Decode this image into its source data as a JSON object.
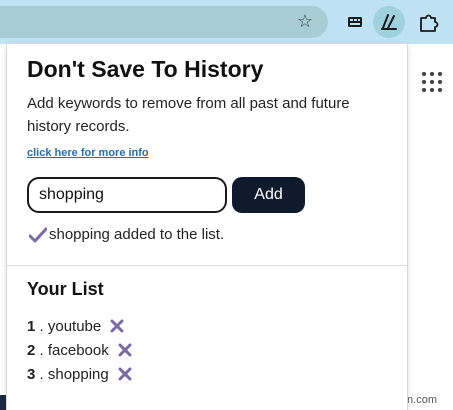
{
  "popup": {
    "title": "Don't Save To History",
    "description": "Add keywords to remove from all past and future history records.",
    "more_info_link": "click here for more info",
    "input_value": "shopping",
    "add_label": "Add",
    "status_message": "shopping added to the list.",
    "list_title": "Your List",
    "items": [
      {
        "number": "1",
        "separator": " . ",
        "label": "youtube"
      },
      {
        "number": "2",
        "separator": " . ",
        "label": "facebook"
      },
      {
        "number": "3",
        "separator": " . ",
        "label": "shopping"
      }
    ]
  },
  "watermark": "wsxdn.com",
  "icons": {
    "bookmark": "star-icon",
    "extension_1": "keyboard-extension-icon",
    "extension_2": "no-history-extension-icon",
    "extensions_menu": "puzzle-icon",
    "apps": "apps-grid-icon",
    "check": "check-icon",
    "remove": "close-icon"
  },
  "colors": {
    "toolbar": "#bfe2f4",
    "omnibox": "#a7cfd3",
    "add_button": "#0f1b2d",
    "link": "#1f6fb8",
    "accent_purple": "#7a68a8"
  }
}
